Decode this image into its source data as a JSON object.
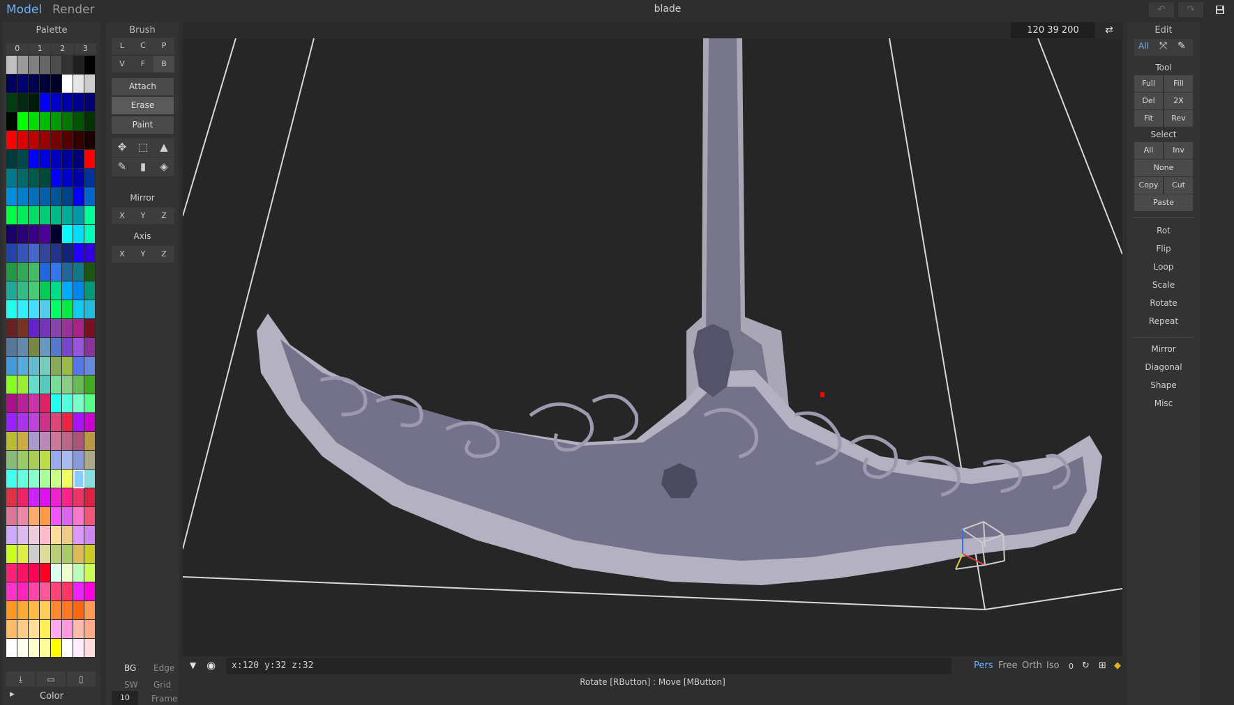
{
  "top_bar": {
    "tabs": [
      "Model",
      "Render"
    ],
    "title": "blade",
    "undo_icon": "undo-icon",
    "redo_icon": "redo-icon",
    "save_icon": "save-icon"
  },
  "palette": {
    "title": "Palette",
    "tabs": [
      "0",
      "1",
      "2",
      "3"
    ],
    "selected_index": 6,
    "colors": [
      "#bfbfbf",
      "#9a9a9a",
      "#808080",
      "#666666",
      "#4d4d4d",
      "#333333",
      "#1f1f1f",
      "#000000",
      "#00005a",
      "#00006e",
      "#000050",
      "#00003a",
      "#000028",
      "#ffffff",
      "#e6e6e6",
      "#cccccc",
      "#003c14",
      "#002a10",
      "#001c0a",
      "#0000ff",
      "#0000cc",
      "#0000aa",
      "#00008c",
      "#000070",
      "#000a00",
      "#00ff00",
      "#00dd00",
      "#00bb00",
      "#009900",
      "#007700",
      "#005500",
      "#003300",
      "#ff0000",
      "#dd0000",
      "#bb0000",
      "#990000",
      "#770000",
      "#550000",
      "#330000",
      "#1a0000",
      "#003a3a",
      "#004a4a",
      "#0000ff",
      "#0000dd",
      "#0000bb",
      "#000099",
      "#000077",
      "#ff0000",
      "#007a8a",
      "#006a6a",
      "#005a4a",
      "#004a3a",
      "#0000ff",
      "#0000cc",
      "#0000aa",
      "#003399",
      "#0090dd",
      "#0080cc",
      "#0070bb",
      "#0060aa",
      "#005599",
      "#004488",
      "#0000ff",
      "#0066cc",
      "#00ff44",
      "#00ee55",
      "#00dd66",
      "#00cc77",
      "#00bb88",
      "#00aa99",
      "#0099aa",
      "#00ff99",
      "#1a0066",
      "#2a0077",
      "#3a0088",
      "#4a0099",
      "#000033",
      "#00ffff",
      "#00ddff",
      "#00ffbb",
      "#2244aa",
      "#3355bb",
      "#4466cc",
      "#334499",
      "#223388",
      "#112277",
      "#2200ff",
      "#3300dd",
      "#229944",
      "#33aa55",
      "#44bb66",
      "#2266dd",
      "#3377ee",
      "#226699",
      "#117788",
      "#1a5511",
      "#22aa99",
      "#33bb88",
      "#44cc77",
      "#00cc55",
      "#00dd88",
      "#00aaff",
      "#0088ee",
      "#009977",
      "#22ffee",
      "#33eeff",
      "#44ddff",
      "#55ccee",
      "#00ff66",
      "#00ee44",
      "#11ccee",
      "#22bbdd",
      "#662222",
      "#773322",
      "#6622cc",
      "#7733bb",
      "#8844aa",
      "#993399",
      "#aa2288",
      "#771122",
      "#557799",
      "#6688aa",
      "#778844",
      "#6699bb",
      "#5577cc",
      "#7744cc",
      "#9955dd",
      "#883399",
      "#4499dd",
      "#55aadd",
      "#66bbcc",
      "#77ccbb",
      "#88aa55",
      "#99bb44",
      "#5577ee",
      "#6688dd",
      "#88ff22",
      "#99ee33",
      "#66ddcc",
      "#55ccbb",
      "#77dd99",
      "#88cc88",
      "#66bb55",
      "#44aa22",
      "#aa1188",
      "#bb2299",
      "#cc33aa",
      "#dd2266",
      "#22ffee",
      "#55ffdd",
      "#77ffcc",
      "#55ff88",
      "#9922ff",
      "#aa33ee",
      "#bb44dd",
      "#cc3388",
      "#dd4477",
      "#ee2244",
      "#aa11ff",
      "#cc00cc",
      "#bbbb33",
      "#ccaa44",
      "#aa99cc",
      "#bb88bb",
      "#cc7799",
      "#bb6688",
      "#aa5577",
      "#bb9944",
      "#88bb77",
      "#99cc66",
      "#aacc55",
      "#bbdd44",
      "#99aaee",
      "#aabbee",
      "#8899dd",
      "#aaaa88",
      "#44ffee",
      "#66ffdd",
      "#88ffcc",
      "#aaff99",
      "#ccff88",
      "#eeff66",
      "#88ccff",
      "#88dddd",
      "#dd3344",
      "#ee2266",
      "#cc22ff",
      "#dd11ee",
      "#ee22cc",
      "#ff2288",
      "#ee3366",
      "#dd2244",
      "#dd7799",
      "#ee88aa",
      "#ffaa66",
      "#ff9944",
      "#ee55ff",
      "#dd66ee",
      "#ff77cc",
      "#ee5577",
      "#ccaaff",
      "#ddbbee",
      "#eeccdd",
      "#ffbbcc",
      "#ffdd99",
      "#eecc88",
      "#dd99ff",
      "#cc88ee",
      "#ccff22",
      "#ddee44",
      "#cccccc",
      "#dddd99",
      "#bbcc77",
      "#aacc66",
      "#ddbb55",
      "#cccc22",
      "#ff2277",
      "#ff1166",
      "#ff0055",
      "#ff0022",
      "#ddffee",
      "#eeffcc",
      "#bbffbb",
      "#ccff55",
      "#ff33cc",
      "#ff22bb",
      "#ff44aa",
      "#ff5599",
      "#ff4477",
      "#ff3366",
      "#ee22ff",
      "#ff00dd",
      "#ff9922",
      "#ffaa33",
      "#ffbb44",
      "#ffcc55",
      "#ff8833",
      "#ff7722",
      "#ff6611",
      "#ff9955",
      "#ffbb66",
      "#ffcc88",
      "#ffdd99",
      "#ffee55",
      "#ffaaee",
      "#ff99dd",
      "#ffbbaa",
      "#ffaa88",
      "#ffffff",
      "#ffffee",
      "#ffffcc",
      "#ffff99",
      "#ffff00",
      "#ffffff",
      "#ffeeff",
      "#ffdddd"
    ],
    "footer_icons": [
      "download-icon",
      "folder-icon",
      "file-icon"
    ],
    "color_label": "Color"
  },
  "brush": {
    "title": "Brush",
    "row1": [
      "L",
      "C",
      "P"
    ],
    "row2": [
      "V",
      "F",
      "B"
    ],
    "actions": [
      "Attach",
      "Erase",
      "Paint"
    ],
    "mirror_label": "Mirror",
    "mirror": [
      "X",
      "Y",
      "Z"
    ],
    "axis_label": "Axis",
    "axis": [
      "X",
      "Y",
      "Z"
    ],
    "bg": "BG",
    "edge": "Edge",
    "sw": "SW",
    "grid": "Grid",
    "frame_value": "10",
    "frame": "Frame"
  },
  "viewport": {
    "dims": "120  39  200",
    "swap_icon": "swap-icon",
    "coords": "x:120 y:32  z:32",
    "views": [
      "Pers",
      "Free",
      "Orth",
      "Iso"
    ],
    "view_count": "0",
    "hint": "Rotate [RButton] : Move [MButton]"
  },
  "edit": {
    "title": "Edit",
    "top_tabs": [
      "All"
    ],
    "tool_label": "Tool",
    "tool_row1": [
      "Full",
      "Fill"
    ],
    "tool_row2": [
      "Del",
      "2X"
    ],
    "tool_row3": [
      "Fit",
      "Rev"
    ],
    "select_label": "Select",
    "select_row1": [
      "All",
      "Inv"
    ],
    "select_none": "None",
    "select_row2": [
      "Copy",
      "Cut"
    ],
    "paste": "Paste",
    "transform": [
      "Rot",
      "Flip",
      "Loop",
      "Scale",
      "Rotate",
      "Repeat"
    ],
    "gen": [
      "Mirror",
      "Diagonal",
      "Shape",
      "Misc"
    ]
  }
}
